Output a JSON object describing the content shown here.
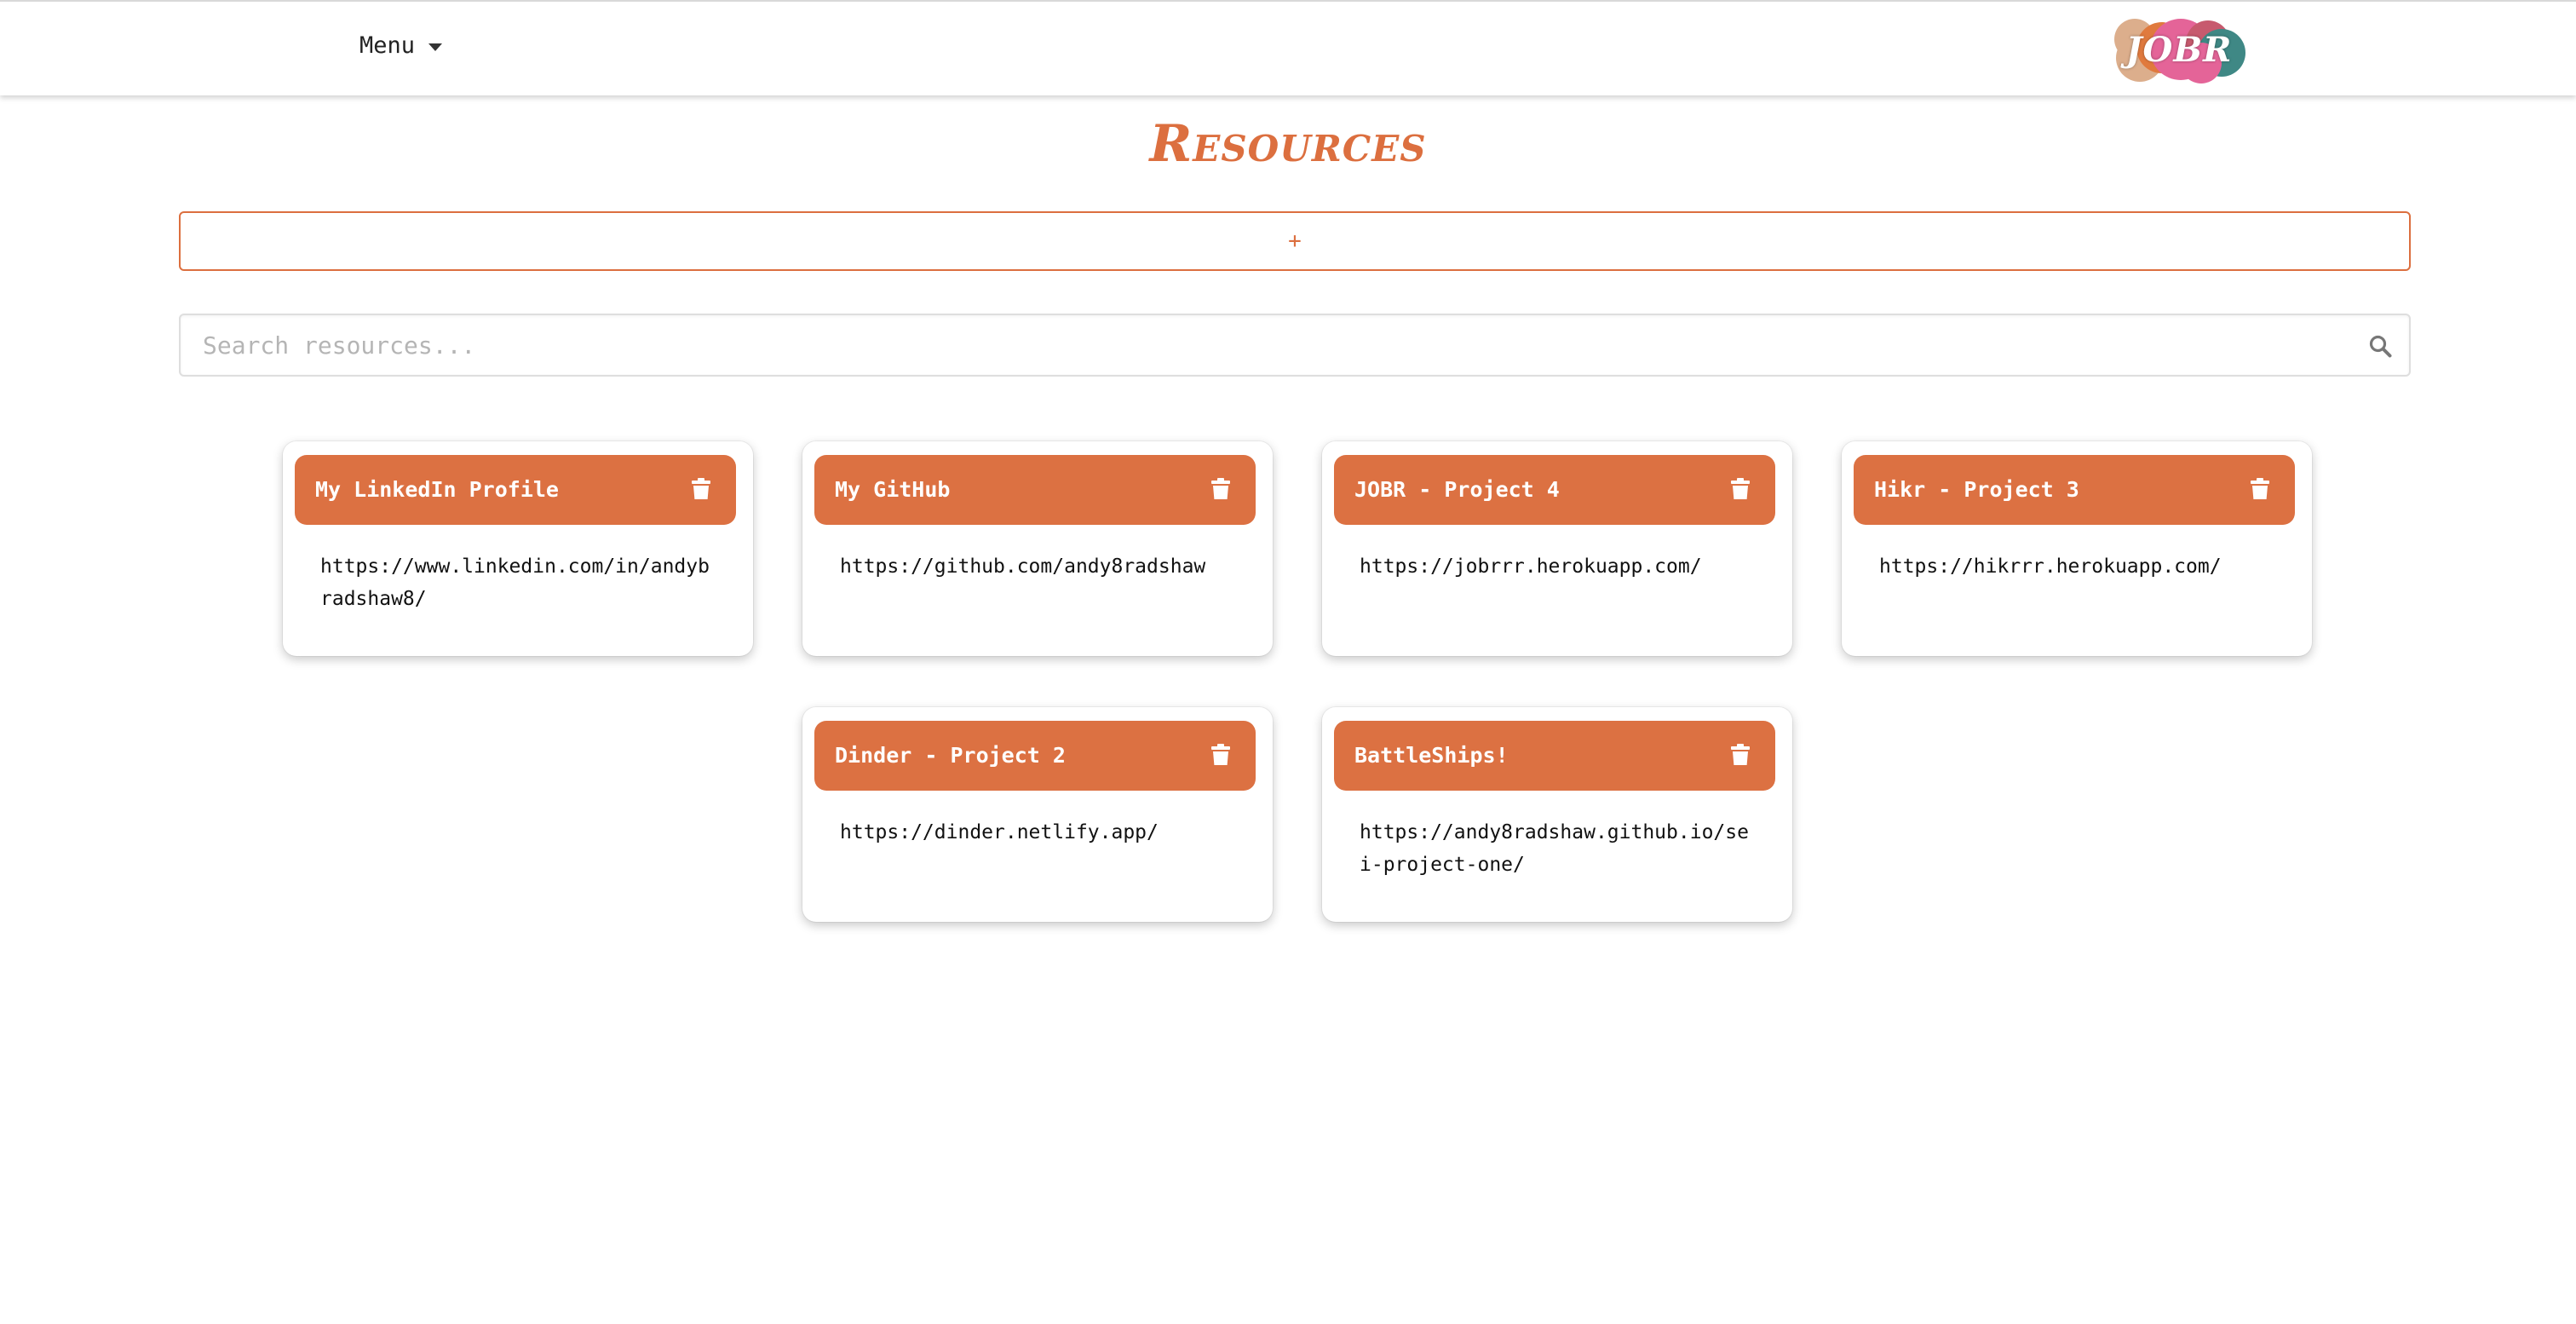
{
  "navbar": {
    "menu_label": "Menu",
    "logo_text": "JOBR"
  },
  "page": {
    "title": "Resources",
    "add_label": "+",
    "search_placeholder": "Search resources..."
  },
  "colors": {
    "accent": "#dc6f3f",
    "card_header": "#dc7142",
    "logo_orange": "#e07a3e",
    "logo_pink": "#e46498",
    "logo_teal": "#3f8885",
    "logo_tan": "#dcae8c"
  },
  "icons": {
    "menu_caret": "caret-down",
    "search": "magnifier",
    "delete": "trash-can"
  },
  "resources": [
    {
      "title": "My LinkedIn Profile",
      "url": "https://www.linkedin.com/in/andybradshaw8/"
    },
    {
      "title": "My GitHub",
      "url": "https://github.com/andy8radshaw"
    },
    {
      "title": "JOBR - Project 4",
      "url": "https://jobrrr.herokuapp.com/"
    },
    {
      "title": "Hikr - Project 3",
      "url": "https://hikrrr.herokuapp.com/"
    },
    {
      "title": "Dinder - Project 2",
      "url": "https://dinder.netlify.app/"
    },
    {
      "title": "BattleShips!",
      "url": "https://andy8radshaw.github.io/sei-project-one/"
    }
  ]
}
